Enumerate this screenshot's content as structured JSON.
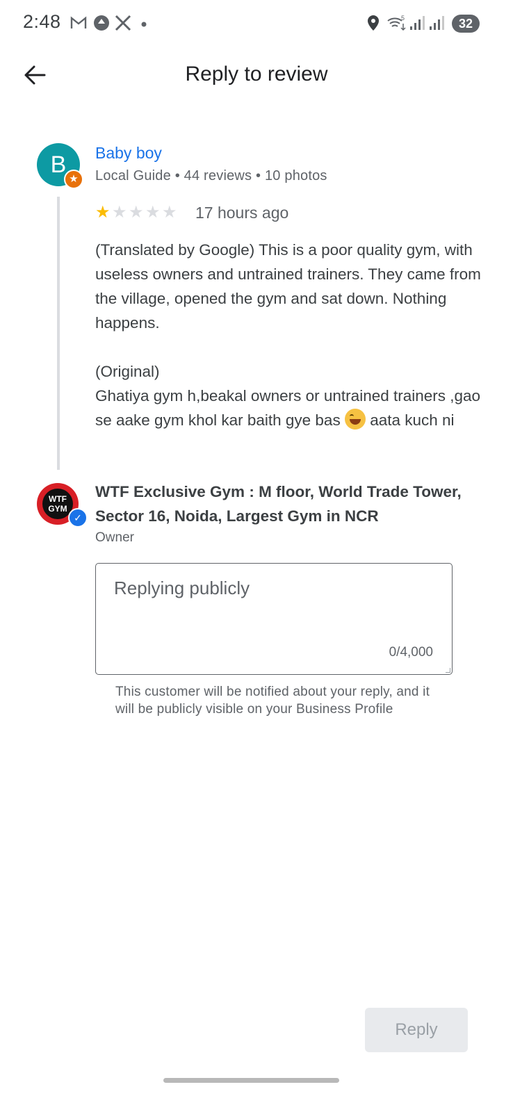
{
  "status_bar": {
    "time": "2:48",
    "left_icons": [
      "gmail-icon",
      "update-icon",
      "x-app-icon",
      "notification-dot-icon"
    ],
    "right_icons": [
      "location-icon",
      "wifi-5g-icon",
      "signal-icon",
      "signal-icon"
    ],
    "battery": "32"
  },
  "header": {
    "title": "Reply to review",
    "back_icon": "arrow-back-icon"
  },
  "review": {
    "reviewer_initial": "B",
    "reviewer_name": "Baby boy",
    "reviewer_meta": "Local Guide • 44 reviews • 10 photos",
    "rating": 1,
    "max_rating": 5,
    "time": "17 hours ago",
    "text_before_emoji": "(Translated by Google) This is a poor quality gym, with useless owners and untrained trainers. They came from the village, opened the gym and sat down. Nothing happens.\n\n(Original)\nGhatiya gym h,beakal owners or untrained trainers ,gao se aake gym khol kar baith gye bas ",
    "emoji": "tears-of-joy-emoji",
    "text_after_emoji": " aata kuch ni"
  },
  "owner": {
    "logo_text": "WTF GYM",
    "name": "WTF Exclusive Gym : M floor, World Trade Tower, Sector 16, Noida, Largest Gym in NCR",
    "role": "Owner"
  },
  "reply": {
    "placeholder": "Replying publicly",
    "value": "",
    "char_count": "0/4,000",
    "helper": "This customer will be notified about your reply, and it will be publicly visible on your Business Profile",
    "button_label": "Reply"
  },
  "colors": {
    "accent": "#1a73e8",
    "star": "#fbbc04",
    "avatar": "#0d9aa3",
    "badge": "#e8710a"
  }
}
